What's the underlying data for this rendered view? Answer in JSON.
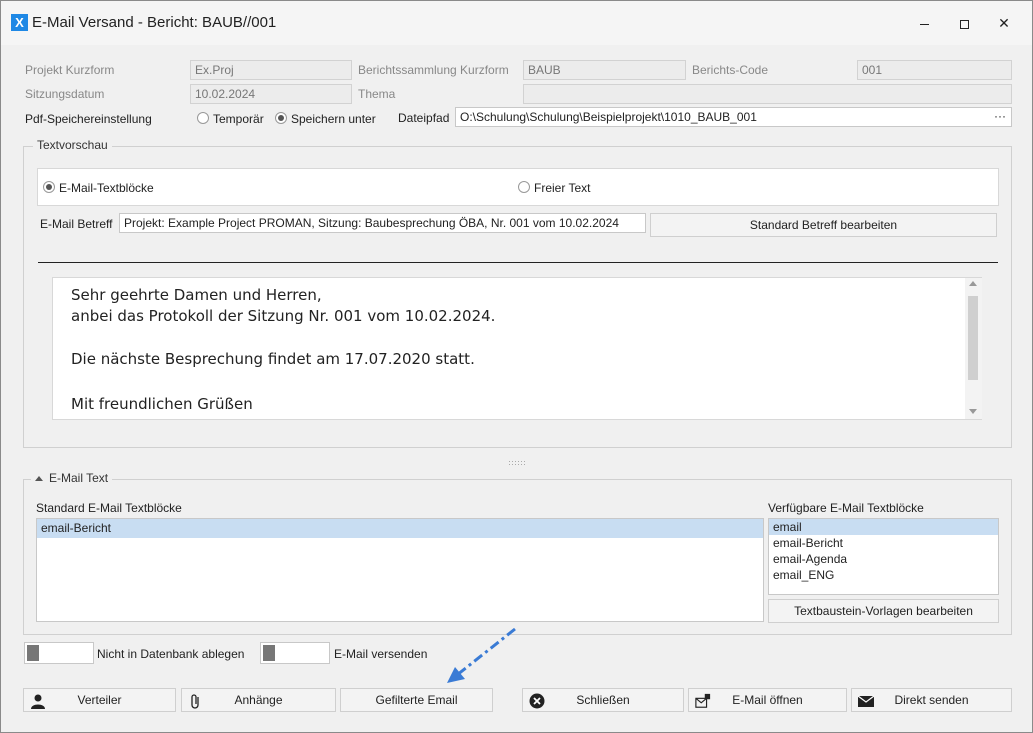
{
  "window": {
    "app_icon": "X",
    "title": "E-Mail Versand - Bericht: BAUB//001",
    "minimize_icon": "minimize-icon",
    "maximize_icon": "maximize-icon",
    "close_icon": "close-icon"
  },
  "header": {
    "projekt_kurzform_label": "Projekt Kurzform",
    "projekt_kurzform_value": "Ex.Proj",
    "berichtssammlung_label": "Berichtssammlung Kurzform",
    "berichtssammlung_value": "BAUB",
    "berichts_code_label": "Berichts-Code",
    "berichts_code_value": "001",
    "sitzungsdatum_label": "Sitzungsdatum",
    "sitzungsdatum_value": "10.02.2024",
    "thema_label": "Thema",
    "thema_value": "",
    "pdf_label": "Pdf-Speichereinstellung",
    "pdf_option_temp": "Temporär",
    "pdf_option_save": "Speichern unter",
    "dateipfad_label": "Dateipfad",
    "dateipfad_value": "O:\\Schulung\\Schulung\\Beispielprojekt\\1010_BAUB_001",
    "browse_label": "···"
  },
  "textvorschau": {
    "title": "Textvorschau",
    "option_textbloecke": "E-Mail-Textblöcke",
    "option_freier_text": "Freier Text",
    "betreff_label": "E-Mail Betreff",
    "betreff_value": "Projekt: Example Project PROMAN, Sitzung: Baubesprechung ÖBA, Nr. 001 vom 10.02.2024",
    "standard_betreff_button": "Standard Betreff bearbeiten",
    "preview_lines": [
      "Sehr geehrte Damen und Herren,",
      "anbei das Protokoll der Sitzung Nr. 001 vom 10.02.2024.",
      "Die nächste Besprechung findet am 17.07.2020 statt.",
      "Mit freundlichen Grüßen"
    ]
  },
  "email_text": {
    "title": "E-Mail Text",
    "standard_label": "Standard E-Mail Textblöcke",
    "standard_items": [
      "email-Bericht"
    ],
    "verfuegbare_label": "Verfügbare E-Mail Textblöcke",
    "verfuegbare_items": [
      "email",
      "email-Bericht",
      "email-Agenda",
      "email_ENG"
    ],
    "vorlagen_button": "Textbaustein-Vorlagen bearbeiten"
  },
  "toggles": {
    "nicht_in_db": "Nicht in Datenbank ablegen",
    "email_versenden": "E-Mail versenden"
  },
  "buttons": {
    "verteiler": "Verteiler",
    "anhaenge": "Anhänge",
    "gefilterte_email": "Gefilterte Email",
    "schliessen": "Schließen",
    "email_oeffnen": "E-Mail öffnen",
    "direkt_senden": "Direkt senden"
  },
  "colors": {
    "accent": "#1e88e5",
    "selection": "#c8ddf2",
    "annotation_arrow": "#3a7bd5"
  }
}
